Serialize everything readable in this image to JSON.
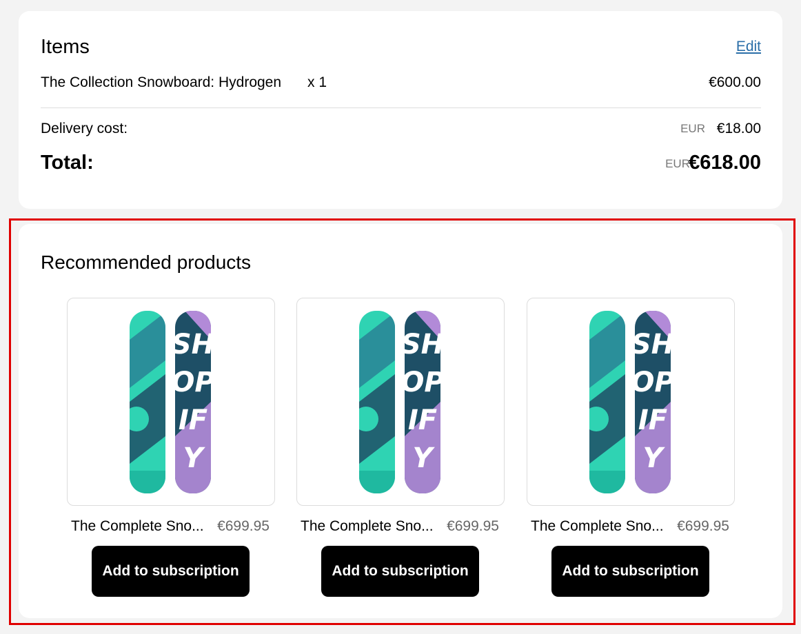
{
  "items_card": {
    "title": "Items",
    "edit_label": "Edit",
    "line": {
      "name": "The Collection Snowboard: Hydrogen",
      "quantity": "x 1",
      "price": "€600.00"
    },
    "delivery": {
      "label": "Delivery cost:",
      "currency": "EUR",
      "value": "€18.00"
    },
    "total": {
      "label": "Total:",
      "currency": "EUR",
      "value": "€618.00"
    }
  },
  "recommended": {
    "title": "Recommended products",
    "products": [
      {
        "name": "The Complete Sno...",
        "price": "€699.95",
        "button": "Add to subscription",
        "image_icon": "snowboard-image"
      },
      {
        "name": "The Complete Sno...",
        "price": "€699.95",
        "button": "Add to subscription",
        "image_icon": "snowboard-image"
      },
      {
        "name": "The Complete Sno...",
        "price": "€699.95",
        "button": "Add to subscription",
        "image_icon": "snowboard-image"
      }
    ]
  },
  "colors": {
    "background": "#f3f3f3",
    "card": "#ffffff",
    "link": "#2a6ea8",
    "button": "#000000",
    "highlight": "#e00000",
    "board_teal": "#2fd3b3",
    "board_dark": "#1e4f66",
    "board_purple": "#b28ad8"
  }
}
